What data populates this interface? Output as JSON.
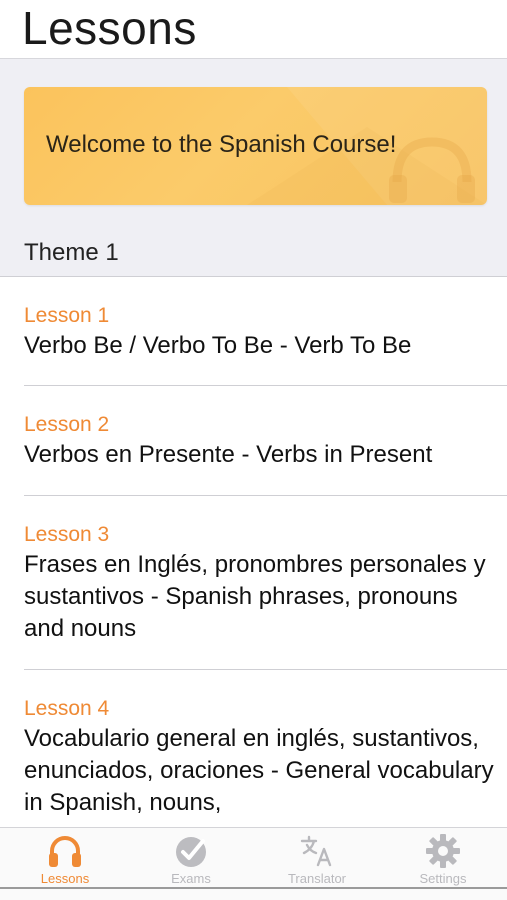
{
  "header": {
    "title": "Lessons"
  },
  "banner": {
    "text": "Welcome to the Spanish Course!"
  },
  "section": {
    "title": "Theme 1"
  },
  "lessons": [
    {
      "number": "Lesson 1",
      "title": "Verbo Be / Verbo To Be - Verb To Be"
    },
    {
      "number": "Lesson 2",
      "title": "Verbos en Presente - Verbs in Present"
    },
    {
      "number": "Lesson 3",
      "title": "Frases en Inglés, pronombres personales y sustantivos - Spanish phrases, pronouns and nouns"
    },
    {
      "number": "Lesson 4",
      "title": "Vocabulario general en inglés, sustantivos, enunciados, oraciones - General vocabulary in Spanish, nouns,"
    }
  ],
  "tabbar": {
    "tabs": [
      {
        "label": "Lessons",
        "icon": "headphones-icon",
        "active": true
      },
      {
        "label": "Exams",
        "icon": "checkmark-circle-icon",
        "active": false
      },
      {
        "label": "Translator",
        "icon": "translate-icon",
        "active": false
      },
      {
        "label": "Settings",
        "icon": "gear-icon",
        "active": false
      }
    ]
  },
  "colors": {
    "accent": "#ef8a35",
    "banner": "#fbc561",
    "background": "#efeff4",
    "inactive_tab": "#b9b9bd"
  }
}
